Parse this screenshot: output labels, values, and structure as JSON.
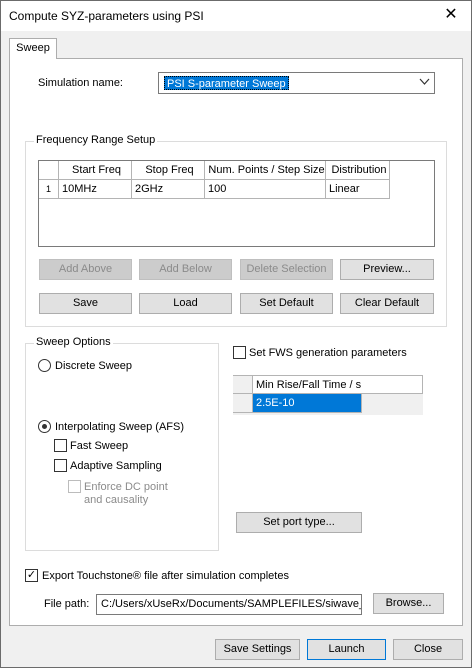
{
  "window": {
    "title": "Compute SYZ-parameters using PSI",
    "close_glyph": "✕"
  },
  "tabs": [
    {
      "label": "Sweep"
    }
  ],
  "simulation": {
    "label": "Simulation name:",
    "value": "PSI S-parameter Sweep"
  },
  "frequency": {
    "title": "Frequency Range Setup",
    "columns": [
      "Start Freq",
      "Stop Freq",
      "Num. Points / Step Size",
      "Distribution"
    ],
    "rows": [
      {
        "num": "1",
        "cells": [
          "10MHz",
          "2GHz",
          "100",
          "Linear"
        ]
      }
    ],
    "buttons": {
      "add_above": "Add Above",
      "add_below": "Add Below",
      "delete_selection": "Delete Selection",
      "preview": "Preview...",
      "save": "Save",
      "load": "Load",
      "set_default": "Set Default",
      "clear_default": "Clear Default"
    }
  },
  "sweep_options": {
    "title": "Sweep Options",
    "discrete": "Discrete Sweep",
    "interpolating": "Interpolating Sweep (AFS)",
    "fast_sweep": "Fast Sweep",
    "adaptive_sampling": "Adaptive Sampling",
    "enforce_dc_1": "Enforce DC point",
    "enforce_dc_2": "and causality",
    "selected": "interpolating"
  },
  "fws": {
    "checkbox_label": "Set FWS generation parameters",
    "column": "Min Rise/Fall Time / s",
    "value": "2.5E-10",
    "set_port_button": "Set port type..."
  },
  "export": {
    "checkbox_label": "Export Touchstone® file after simulation completes",
    "checked": true,
    "checkmark": "✓",
    "file_path_label": "File path:",
    "file_path": "C:/Users/xUseRx/Documents/SAMPLEFILES/siwave_b",
    "browse": "Browse..."
  },
  "footer": {
    "save_settings": "Save Settings",
    "launch": "Launch",
    "close": "Close"
  }
}
